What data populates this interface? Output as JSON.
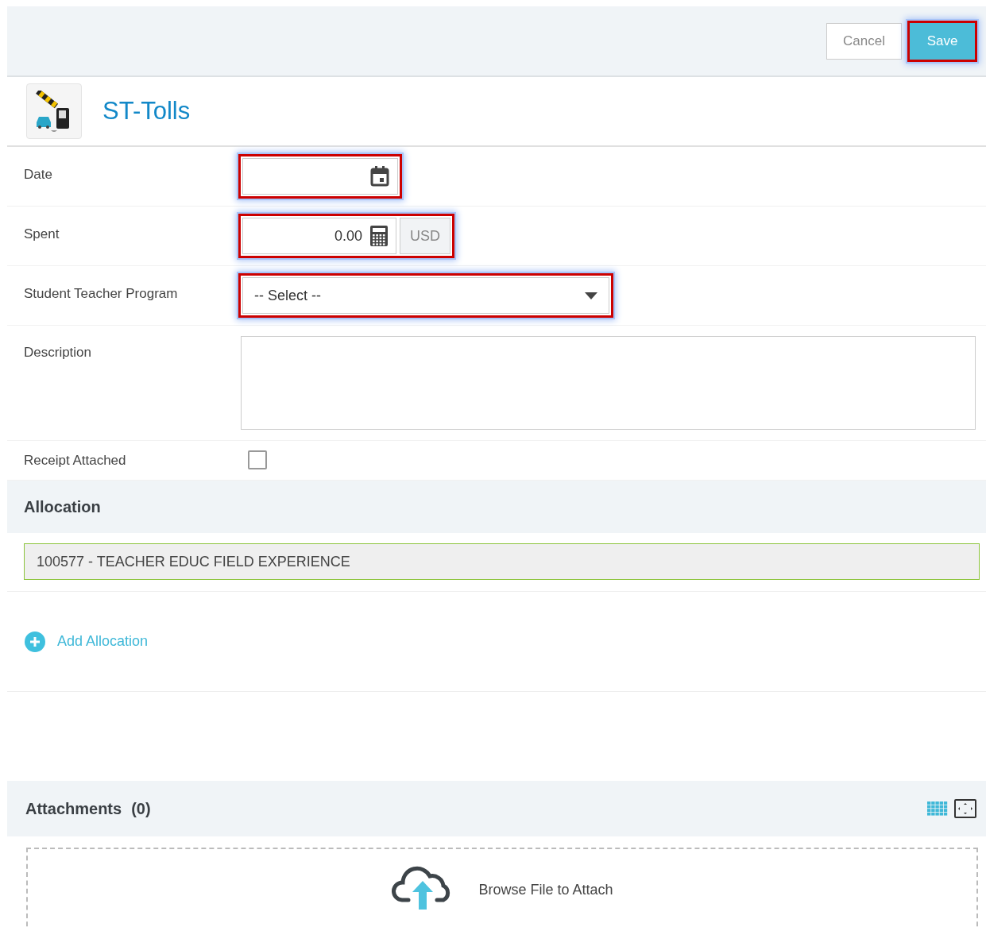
{
  "toolbar": {
    "buttons": [
      {
        "label": "Cancel",
        "kind": "secondary",
        "highlighted": false
      },
      {
        "label": "Save",
        "kind": "primary",
        "highlighted": true
      }
    ]
  },
  "title": "ST-Tolls",
  "fields": [
    {
      "label": "Date",
      "kind": "date",
      "highlighted": true
    },
    {
      "label": "Spent",
      "kind": "money",
      "value": "0.00",
      "currency": "USD",
      "highlighted": true
    },
    {
      "label": "Student Teacher Program",
      "kind": "select",
      "value": "-- Select --",
      "highlighted": true
    },
    {
      "label": "Description",
      "kind": "textarea",
      "highlighted": false
    },
    {
      "label": "Receipt Attached",
      "kind": "checkbox",
      "checked": false,
      "highlighted": false
    }
  ],
  "allocation": {
    "heading": "Allocation",
    "items": [
      "100577 - TEACHER EDUC FIELD EXPERIENCE"
    ],
    "add_label": "Add Allocation"
  },
  "attachments": {
    "heading": "Attachments",
    "count": "(0)",
    "drop_label": "Browse File to Attach"
  }
}
